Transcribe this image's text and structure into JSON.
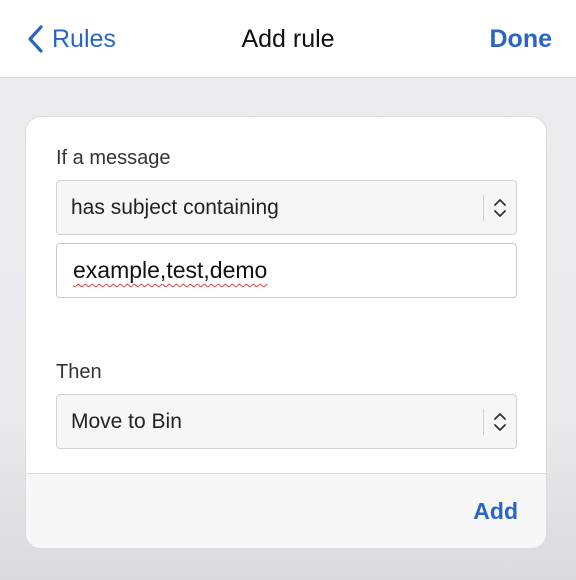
{
  "nav": {
    "back_label": "Rules",
    "title": "Add rule",
    "done_label": "Done"
  },
  "condition": {
    "label": "If a message",
    "selected": "has subject containing",
    "value": "example,test,demo"
  },
  "action": {
    "label": "Then",
    "selected": "Move to Bin"
  },
  "footer": {
    "add_label": "Add"
  },
  "colors": {
    "accent": "#2a64c5",
    "spellcheck": "#d9463d"
  },
  "icons": [
    "chevron-left-icon",
    "updown-chevron-icon"
  ]
}
